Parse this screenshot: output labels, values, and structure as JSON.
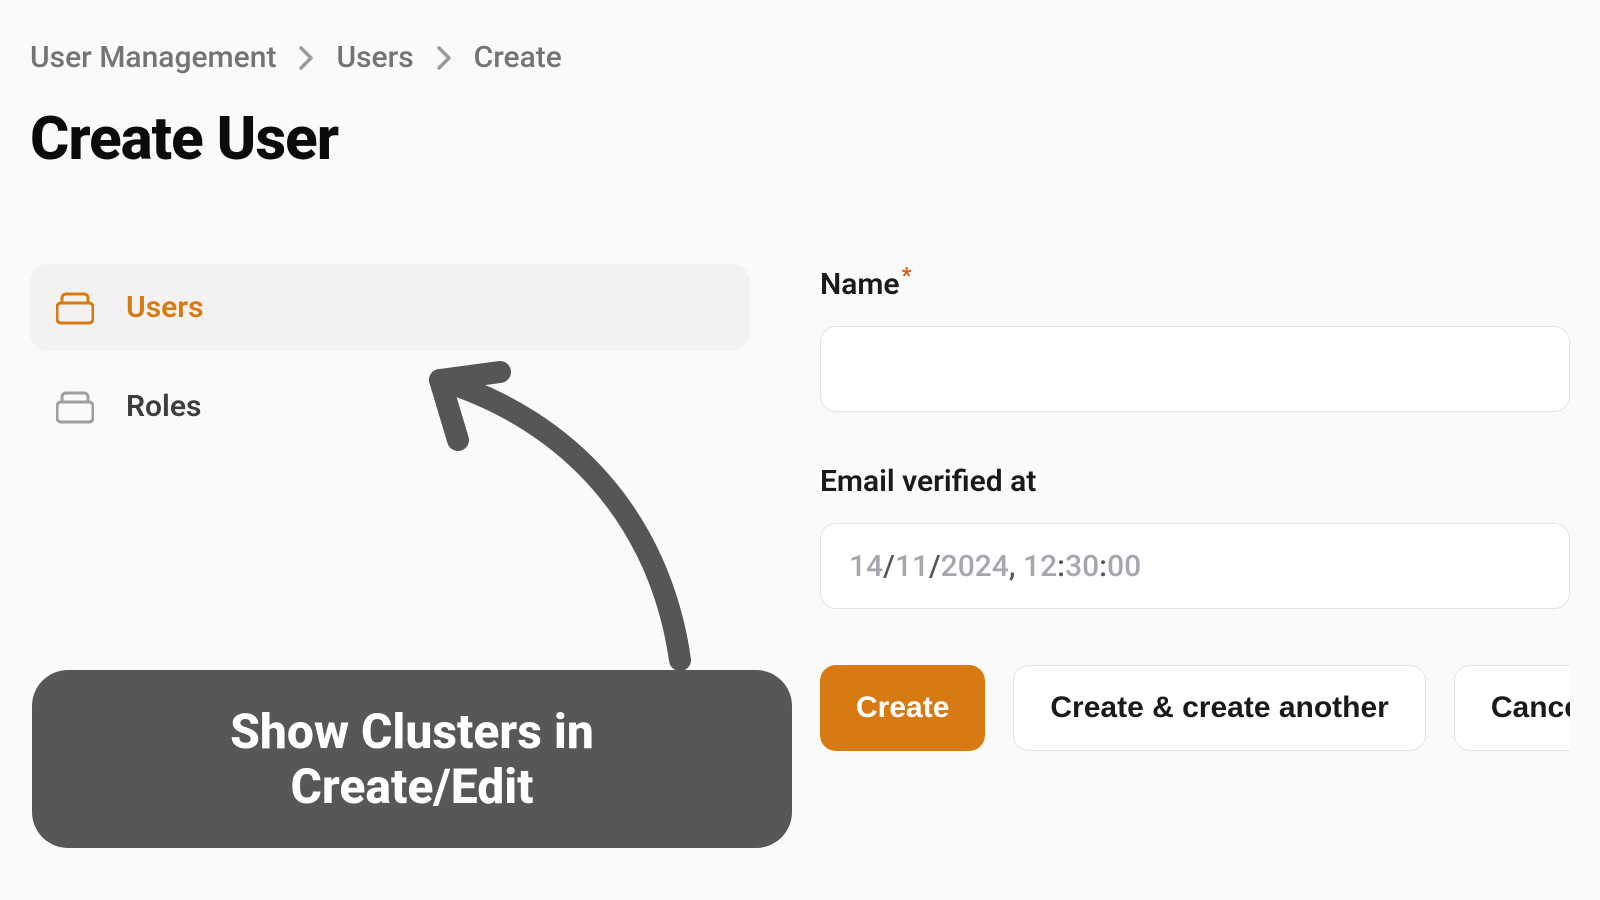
{
  "breadcrumb": {
    "items": [
      "User Management",
      "Users",
      "Create"
    ]
  },
  "page_title": "Create User",
  "sidebar": {
    "items": [
      {
        "label": "Users",
        "active": true
      },
      {
        "label": "Roles",
        "active": false
      }
    ]
  },
  "form": {
    "name": {
      "label": "Name",
      "required": true,
      "value": ""
    },
    "email_verified_at": {
      "label": "Email verified at",
      "value": "14/11/2024, 12:30:00",
      "parts": {
        "day": "14",
        "month": "11",
        "year": "2024",
        "hour": "12",
        "min": "30",
        "sec": "00"
      }
    }
  },
  "buttons": {
    "create": "Create",
    "create_another": "Create & create another",
    "cancel": "Cancel"
  },
  "annotation": {
    "text_line1": "Show Clusters in",
    "text_line2": "Create/Edit"
  },
  "colors": {
    "accent": "#d77a13",
    "callout_bg": "#575757"
  }
}
